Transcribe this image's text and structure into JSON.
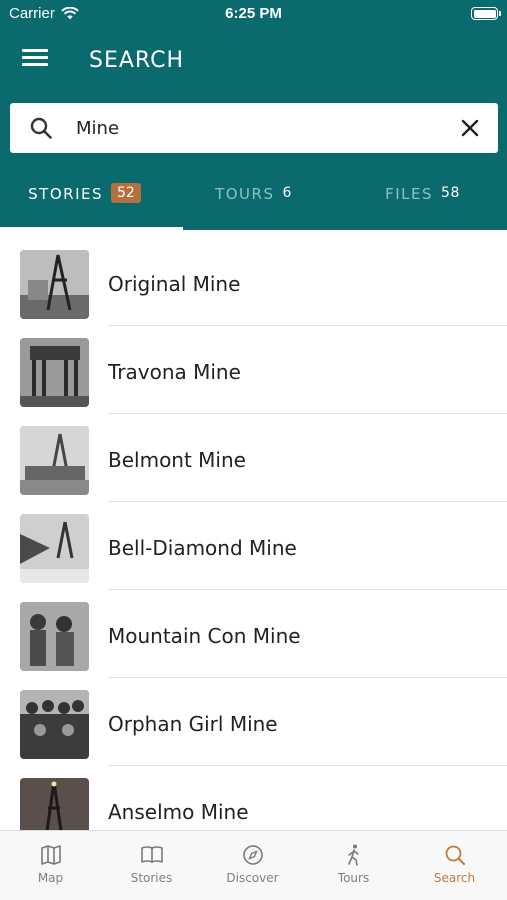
{
  "status_bar": {
    "carrier": "Carrier",
    "time": "6:25 PM"
  },
  "header": {
    "title": "SEARCH"
  },
  "search": {
    "value": "Mine",
    "placeholder": ""
  },
  "tabs": [
    {
      "label": "STORIES",
      "count": "52",
      "active": true
    },
    {
      "label": "TOURS",
      "count": "6",
      "active": false
    },
    {
      "label": "FILES",
      "count": "58",
      "active": false
    }
  ],
  "results": [
    {
      "title": "Original Mine"
    },
    {
      "title": "Travona Mine"
    },
    {
      "title": "Belmont Mine"
    },
    {
      "title": "Bell-Diamond Mine"
    },
    {
      "title": "Mountain Con Mine"
    },
    {
      "title": "Orphan Girl Mine"
    },
    {
      "title": "Anselmo Mine"
    }
  ],
  "tabbar": [
    {
      "label": "Map",
      "icon": "map-icon"
    },
    {
      "label": "Stories",
      "icon": "book-icon"
    },
    {
      "label": "Discover",
      "icon": "compass-icon"
    },
    {
      "label": "Tours",
      "icon": "walking-person-icon"
    },
    {
      "label": "Search",
      "icon": "search-icon",
      "active": true
    }
  ],
  "colors": {
    "header": "#0b6a6d",
    "badge": "#b5703e",
    "active_tab": "#c07a3e"
  }
}
